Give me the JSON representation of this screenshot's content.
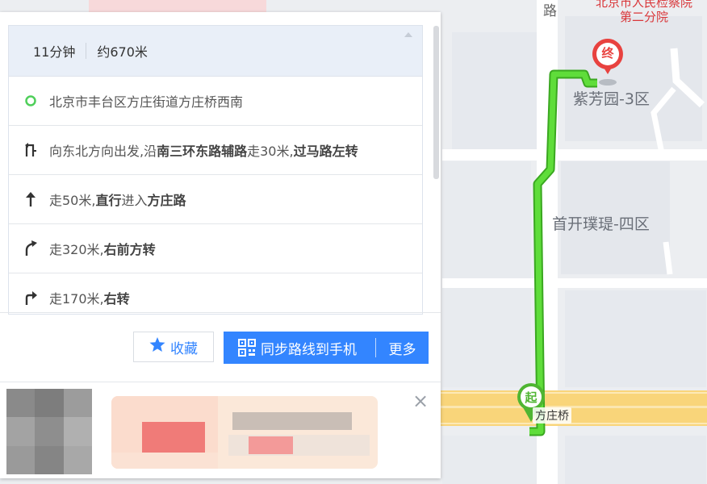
{
  "map": {
    "labels": {
      "top_poi_line1": "北京市人民检察院",
      "top_poi_line2": "第二分院",
      "residential_1": "紫芳园-3区",
      "residential_2": "首开璞瑅-四区",
      "road_vertical": "路",
      "bridge": "方庄桥"
    },
    "markers": {
      "start": "起",
      "end": "终"
    },
    "route_color": "#52d134",
    "end_marker_color": "#e8423f",
    "start_marker_color": "#4fb532"
  },
  "route": {
    "duration": "11分钟",
    "distance": "约670米",
    "steps": [
      {
        "icon": "start-circle-icon",
        "parts": [
          {
            "t": "北京市丰台区方庄街道方庄桥西南",
            "b": false
          }
        ]
      },
      {
        "icon": "turn-left-icon",
        "parts": [
          {
            "t": "向东北方向出发,沿",
            "b": false
          },
          {
            "t": "南三环东路辅路",
            "b": true
          },
          {
            "t": "走30米,",
            "b": false
          },
          {
            "t": "过马路左转",
            "b": true
          }
        ]
      },
      {
        "icon": "straight-arrow-icon",
        "parts": [
          {
            "t": "走50米,",
            "b": false
          },
          {
            "t": "直行",
            "b": true
          },
          {
            "t": "进入",
            "b": false
          },
          {
            "t": "方庄路",
            "b": true
          }
        ]
      },
      {
        "icon": "bear-right-icon",
        "parts": [
          {
            "t": "走320米,",
            "b": false
          },
          {
            "t": "右前方转",
            "b": true
          }
        ]
      },
      {
        "icon": "turn-right-icon",
        "parts": [
          {
            "t": "走170米,",
            "b": false
          },
          {
            "t": "右转",
            "b": true
          }
        ]
      }
    ]
  },
  "actions": {
    "favorite": "收藏",
    "sync_to_phone": "同步路线到手机",
    "more": "更多"
  },
  "ad": {
    "close": "×"
  },
  "colors": {
    "primary": "#3385ff"
  }
}
